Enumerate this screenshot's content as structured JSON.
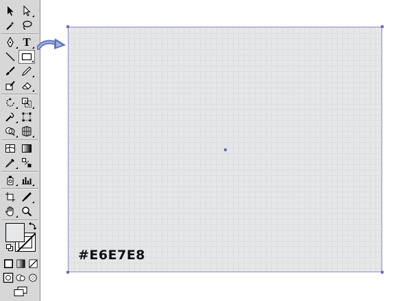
{
  "toolbar": {
    "rows": [
      [
        "selection-tool",
        "direct-selection-tool"
      ],
      [
        "magic-wand-tool",
        "lasso-tool"
      ],
      [
        "pen-tool",
        "type-tool"
      ],
      [
        "line-segment-tool",
        "rectangle-tool"
      ],
      [
        "paintbrush-tool",
        "pencil-tool"
      ],
      [
        "blob-brush-tool",
        "eraser-tool"
      ],
      [
        "rotate-tool",
        "scale-tool"
      ],
      [
        "warp-tool",
        "free-transform-tool"
      ],
      [
        "shape-builder-tool",
        "perspective-grid-tool"
      ],
      [
        "mesh-tool",
        "gradient-tool"
      ],
      [
        "eyedropper-tool",
        "blend-tool"
      ],
      [
        "symbol-sprayer-tool",
        "column-graph-tool"
      ],
      [
        "artboard-tool",
        "slice-tool"
      ],
      [
        "hand-tool",
        "zoom-tool"
      ]
    ],
    "active_tool": "rectangle-tool",
    "type_tool_glyph": "T"
  },
  "colors": {
    "fill": "#E6E7E8",
    "stroke": "none",
    "accent": "#6B6FB5",
    "arrow": "#5A6FB8"
  },
  "canvas": {
    "hex_label": "#E6E7E8"
  }
}
